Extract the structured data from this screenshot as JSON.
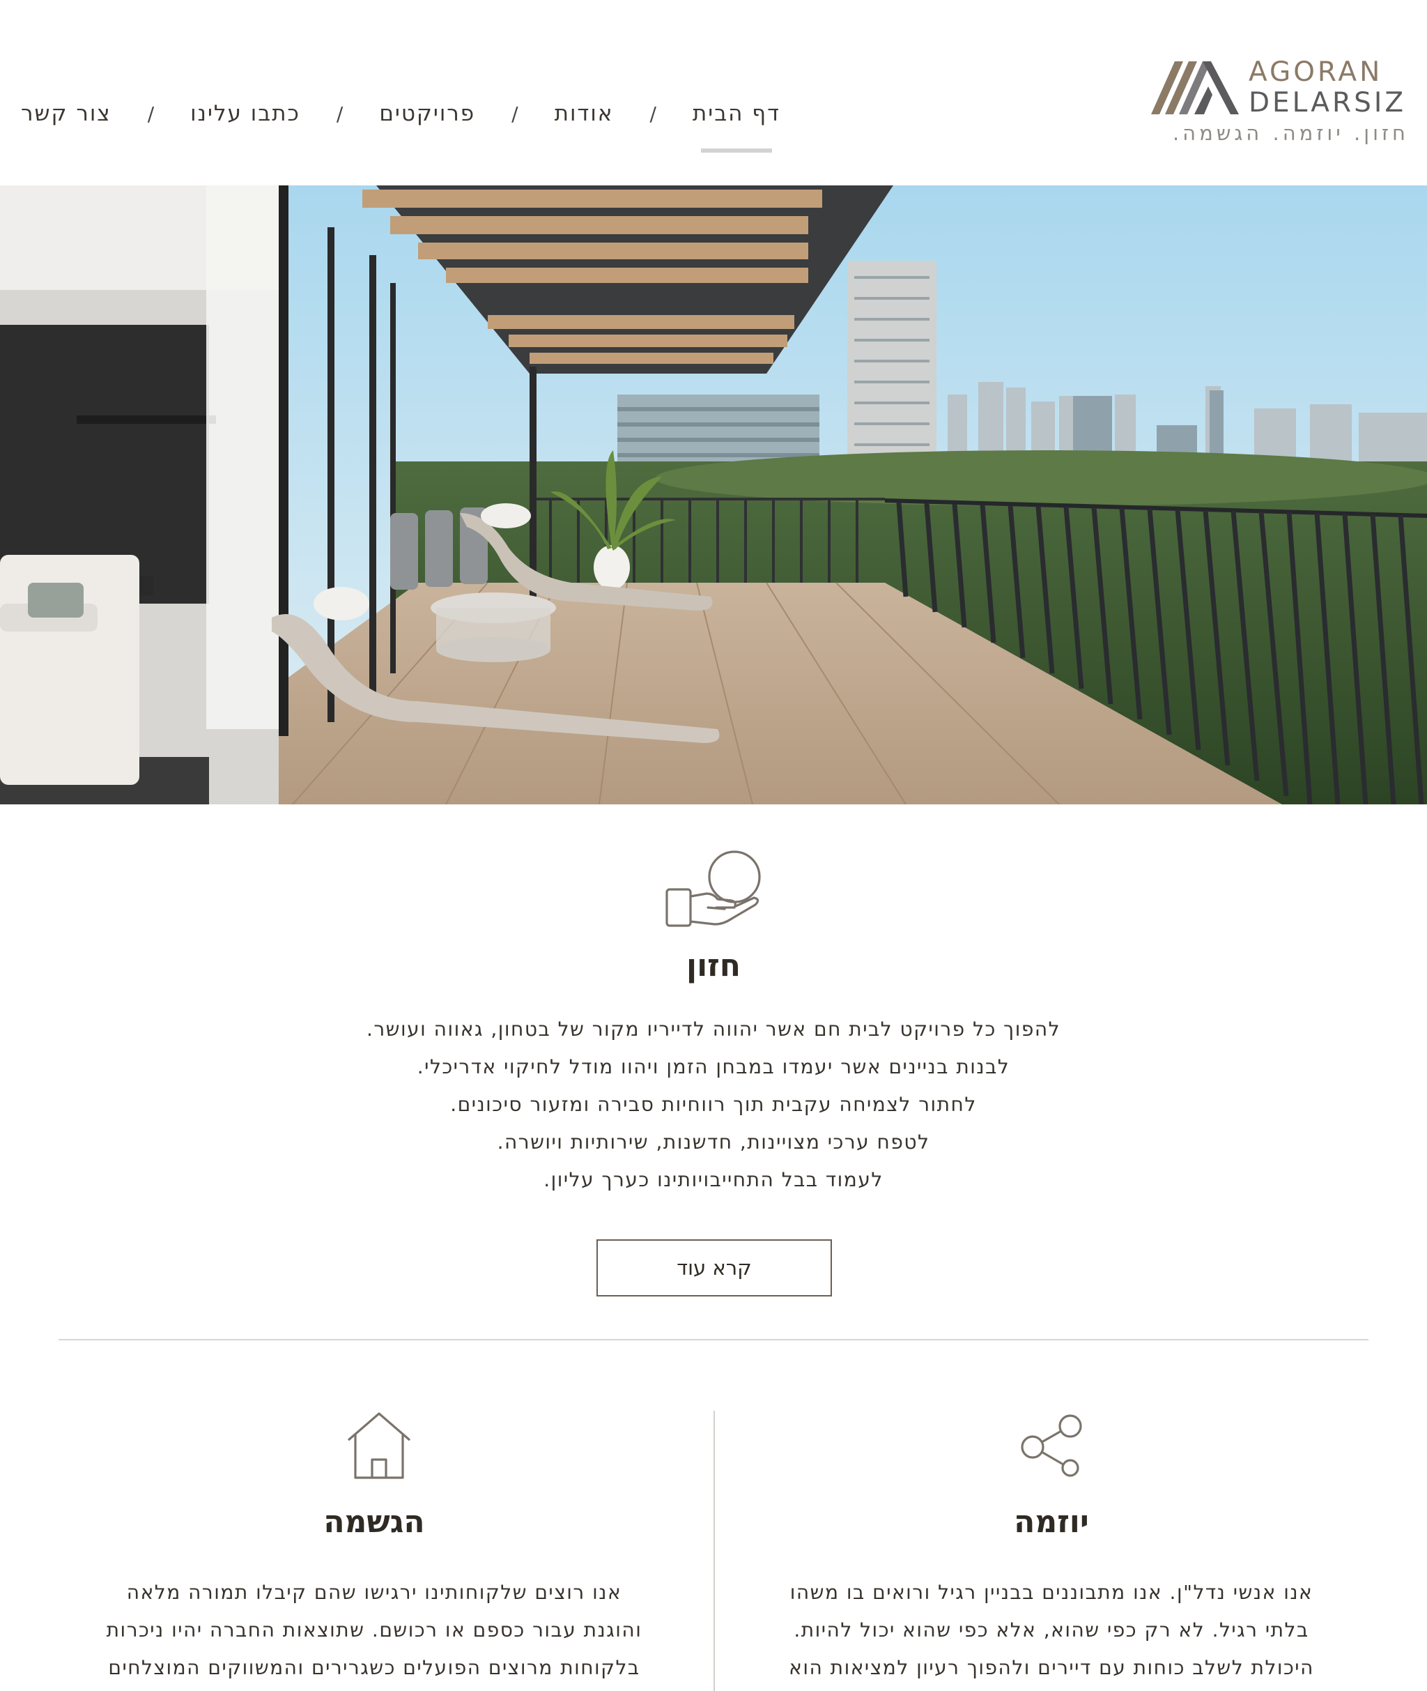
{
  "header": {
    "logo": {
      "line1": "AGORAN",
      "line2": "DELARSIZ",
      "tagline": "חזון. יוזמה. הגשמה."
    },
    "nav": {
      "items": [
        {
          "label": "דף הבית",
          "active": true
        },
        {
          "label": "אודות",
          "active": false
        },
        {
          "label": "פרויקטים",
          "active": false
        },
        {
          "label": "כתבו עלינו",
          "active": false
        },
        {
          "label": "צור קשר",
          "active": false
        }
      ],
      "separator": "/"
    }
  },
  "hero": {
    "image_alt": "מרפסת עם נוף לעיר"
  },
  "vision": {
    "icon": "hand-holding-circle-icon",
    "title": "חזון",
    "lines": [
      "להפוך כל פרויקט לבית חם אשר יהווה לדייריו מקור של בטחון, גאווה ועושר.",
      "לבנות בניינים אשר יעמדו במבחן הזמן ויהוו מודל לחיקוי אדריכלי.",
      "לחתור לצמיחה עקבית תוך רווחיות סבירה ומזעור סיכונים.",
      "לטפח ערכי מצויינות, חדשנות, שירותיות ויושרה.",
      "לעמוד בבל התחייבויותינו כערך עליון."
    ],
    "read_more": "קרא עוד"
  },
  "pillars": {
    "initiative": {
      "icon": "share-icon",
      "title": "יוזמה",
      "lines": [
        "אנו אנשי נדל\"ן.  אנו מתבוננים בבניין רגיל ורואים בו משהו",
        "בלתי רגיל.  לא רק כפי שהוא, אלא כפי שהוא יכול להיות.",
        "היכולת לשלב כוחות עם דיירים ולהפוך רעיון למציאות הוא"
      ]
    },
    "realization": {
      "icon": "house-icon",
      "title": "הגשמה",
      "lines": [
        "אנו רוצים שלקוחותינו ירגישו שהם קיבלו תמורה מלאה",
        "והוגנת עבור כספם או רכושם.   שתוצאות החברה יהיו ניכרות",
        "בלקוחות מרוצים הפועלים כשגרירים והמשווקים המוצלחים"
      ]
    }
  },
  "colors": {
    "logo_brown": "#8b7a66",
    "logo_gray": "#5b5a5c",
    "text": "#2f2a24",
    "divider": "#d9d6d2",
    "active_underline": "#d3d3d3"
  }
}
